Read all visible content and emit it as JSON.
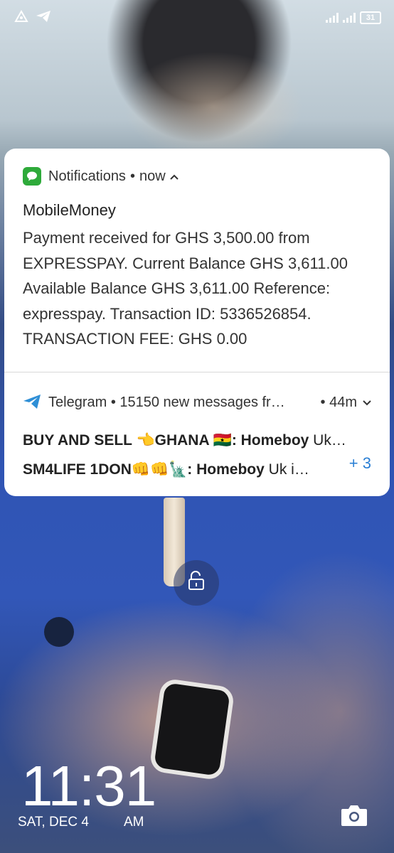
{
  "status_bar": {
    "left_icons": [
      "nav-delta-icon",
      "telegram-send-icon"
    ],
    "battery": "31"
  },
  "notification_mobilemoney": {
    "app_name": "Notifications",
    "separator": "•",
    "time": "now",
    "title": "MobileMoney",
    "body_lines": [
      "Payment received for GHS 3,500.00 from",
      "EXPRESSPAY. Current Balance GHS 3,611.00",
      "Available Balance GHS 3,611.00 Reference:",
      "expresspay. Transaction ID: 5336526854.",
      "TRANSACTION FEE: GHS 0.00"
    ]
  },
  "notification_telegram": {
    "header": "Telegram • 15150 new messages fr…",
    "time": "• 44m",
    "line1_sender": "BUY AND SELL 👈GHANA 🇬🇭: Homeboy",
    "line1_text": " Uk…",
    "line2_sender": "SM4LIFE 1DON👊👊🗽: Homeboy",
    "line2_text": " Uk i…",
    "more_count": "+ 3"
  },
  "lockscreen": {
    "time": "11:31",
    "date": "SAT, DEC 4",
    "ampm": "AM"
  },
  "colors": {
    "accent_blue": "#2a7fd4",
    "messages_green": "#2eaa3a",
    "telegram_blue": "#2f8fd6"
  }
}
